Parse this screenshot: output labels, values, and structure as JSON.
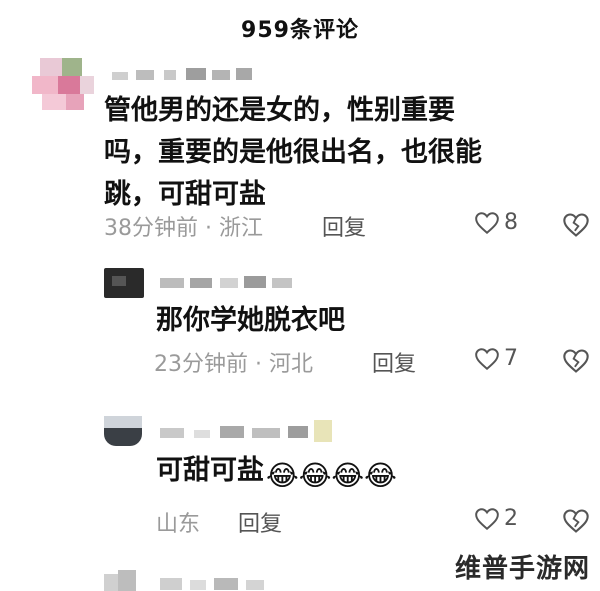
{
  "header": {
    "title": "959条评论"
  },
  "comments": [
    {
      "text": "管他男的还是女的，性别重要吗，重要的是他很出名，也很能跳，可甜可盐",
      "lines": [
        "管他男的还是女的，性别重要",
        "吗，重要的是他很出名，也很能",
        "跳，可甜可盐"
      ],
      "meta": "38分钟前 · 浙江",
      "reply_label": "回复",
      "likes": "8"
    },
    {
      "text": "那你学她脱衣吧",
      "meta": "23分钟前 · 河北",
      "reply_label": "回复",
      "likes": "7"
    },
    {
      "text": "可甜可盐",
      "emoji": "😂😂😂😂",
      "meta": "山东",
      "reply_label": "回复",
      "likes": "2"
    }
  ],
  "watermark": "维普手游网",
  "colors": {
    "meta": "#9a9a9a",
    "text": "#111111",
    "icon": "#555555"
  }
}
